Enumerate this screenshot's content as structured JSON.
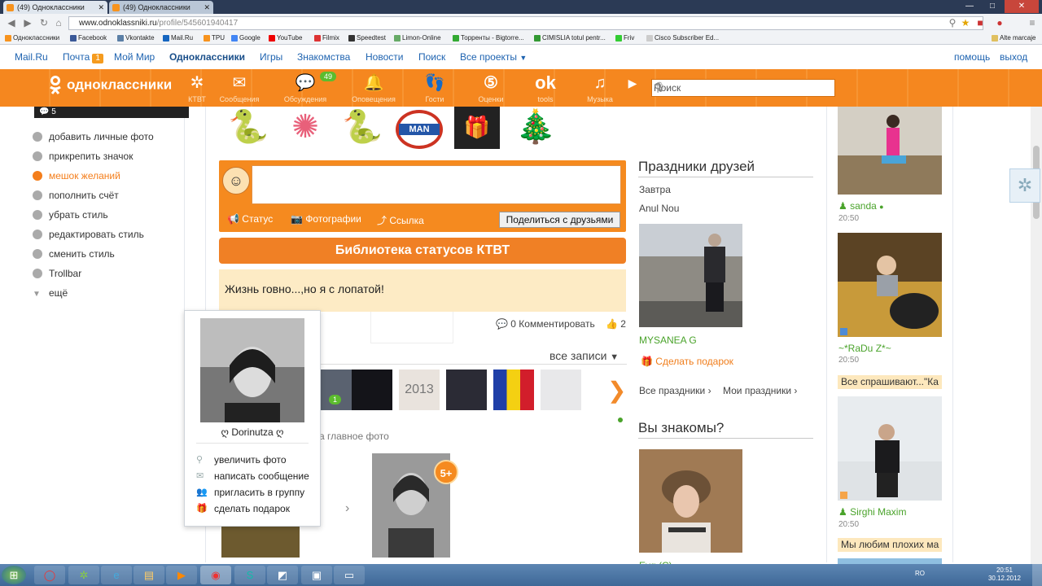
{
  "browser": {
    "tabs": [
      {
        "label": "(49) Одноклассники",
        "active": true
      },
      {
        "label": "(49) Одноклассники",
        "active": false
      }
    ],
    "url_host": "www.odnoklassniki.ru",
    "url_path": "/profile/545601940417",
    "bookmarks": [
      "Одноклассники",
      "Facebook",
      "Vkontakte",
      "Mail.Ru",
      "TPU",
      "Google",
      "YouTube",
      "Filmix",
      "Speedtest",
      "Limon-Online",
      "Торренты - Bigtorre...",
      "CIMISLIA totul pentr...",
      "Friv",
      "Cisco Subscriber Ed..."
    ],
    "other_bookmarks": "Alte marcaje"
  },
  "topnav": {
    "items": [
      "Mail.Ru",
      "Почта",
      "Мой Мир",
      "Одноклассники",
      "Игры",
      "Знакомства",
      "Новости",
      "Поиск",
      "Все проекты"
    ],
    "mail_count": "1",
    "help": "помощь",
    "logout": "выход"
  },
  "header": {
    "logo": "одноклассники",
    "items": [
      {
        "label": "КТВТ",
        "icon": "ktvt-icon"
      },
      {
        "label": "Сообщения",
        "icon": "envelope-icon"
      },
      {
        "label": "Обсуждения",
        "icon": "chat-icon",
        "badge": "49"
      },
      {
        "label": "Оповещения",
        "icon": "bell-icon"
      },
      {
        "label": "Гости",
        "icon": "footprints-icon"
      },
      {
        "label": "Оценки",
        "icon": "rating-icon"
      },
      {
        "label": "tools",
        "icon": "ok-icon"
      },
      {
        "label": "Музыка",
        "icon": "music-icon"
      }
    ],
    "search_placeholder": "Поиск"
  },
  "left_menu": {
    "counter": "5",
    "items": [
      {
        "label": "добавить личные фото",
        "highlight": false
      },
      {
        "label": "прикрепить значок",
        "highlight": false
      },
      {
        "label": "мешок желаний",
        "highlight": true
      },
      {
        "label": "пополнить счёт",
        "highlight": false
      },
      {
        "label": "убрать стиль",
        "highlight": false
      },
      {
        "label": "редактировать стиль",
        "highlight": false
      },
      {
        "label": "сменить стиль",
        "highlight": false
      },
      {
        "label": "Trollbar",
        "highlight": false
      },
      {
        "label": "ещё",
        "highlight": false
      }
    ]
  },
  "composer": {
    "status": "Статус",
    "photos": "Фотографии",
    "link": "Ссылка",
    "share": "Поделиться с друзьями"
  },
  "library_title": "Библиотека статусов КТВТ",
  "status_text": "Жизнь говно...,но я с лопатой!",
  "status_actions": {
    "comment": "0 Комментировать",
    "likes": "2"
  },
  "all_posts": "все записи",
  "main_photo_label": "а главное фото",
  "photo_badge": "5+",
  "popup": {
    "name": "ღ Dorinutza ღ",
    "actions": [
      {
        "label": "увеличить фото",
        "icon": "zoom-icon"
      },
      {
        "label": "написать сообщение",
        "icon": "envelope-icon"
      },
      {
        "label": "пригласить в группу",
        "icon": "group-icon"
      },
      {
        "label": "сделать подарок",
        "icon": "gift-icon"
      }
    ]
  },
  "holidays": {
    "title": "Праздники друзей",
    "when": "Завтра",
    "person": "Anul Nou",
    "friend": "MYSANEA G",
    "gift": "Сделать подарок",
    "all": "Все праздники",
    "mine": "Мои праздники"
  },
  "know": {
    "title": "Вы знакомы?",
    "name": "Еуg (С)"
  },
  "online_feed": [
    {
      "name": "sanda",
      "time": "20:50"
    },
    {
      "name": "~*RaDu Z*~",
      "time": "20:50"
    },
    {
      "ask": "Все спрашивают...\"Ка",
      "name": "Sirghi Maxim",
      "time": "20:50"
    },
    {
      "ask": "Мы любим плохих ма"
    }
  ],
  "taskbar": {
    "lang": "RO",
    "time": "20:51",
    "date": "30.12.2012"
  }
}
